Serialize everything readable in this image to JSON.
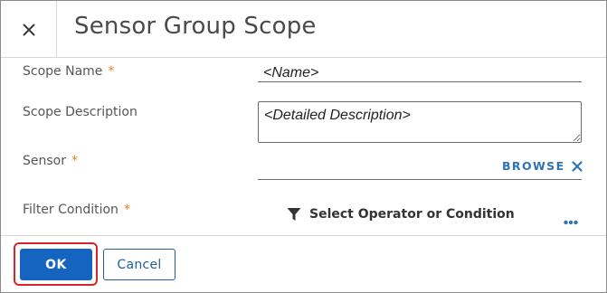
{
  "dialog": {
    "title": "Sensor Group Scope"
  },
  "form": {
    "scope_name": {
      "label": "Scope Name",
      "required_mark": "*",
      "value": "<Name>"
    },
    "scope_description": {
      "label": "Scope Description",
      "value": "<Detailed Description>"
    },
    "sensor": {
      "label": "Sensor",
      "required_mark": "*",
      "browse_label": "BROWSE"
    },
    "filter_condition": {
      "label": "Filter Condition",
      "required_mark": "*",
      "button_label": "Select Operator or Condition"
    }
  },
  "footer": {
    "ok_label": "OK",
    "cancel_label": "Cancel"
  },
  "colors": {
    "primary": "#1565c0",
    "link": "#2f73b4",
    "required": "#e2841f",
    "highlight": "#d9232e"
  },
  "icons": [
    "close-icon",
    "clear-icon",
    "filter-icon",
    "more-options-icon"
  ]
}
